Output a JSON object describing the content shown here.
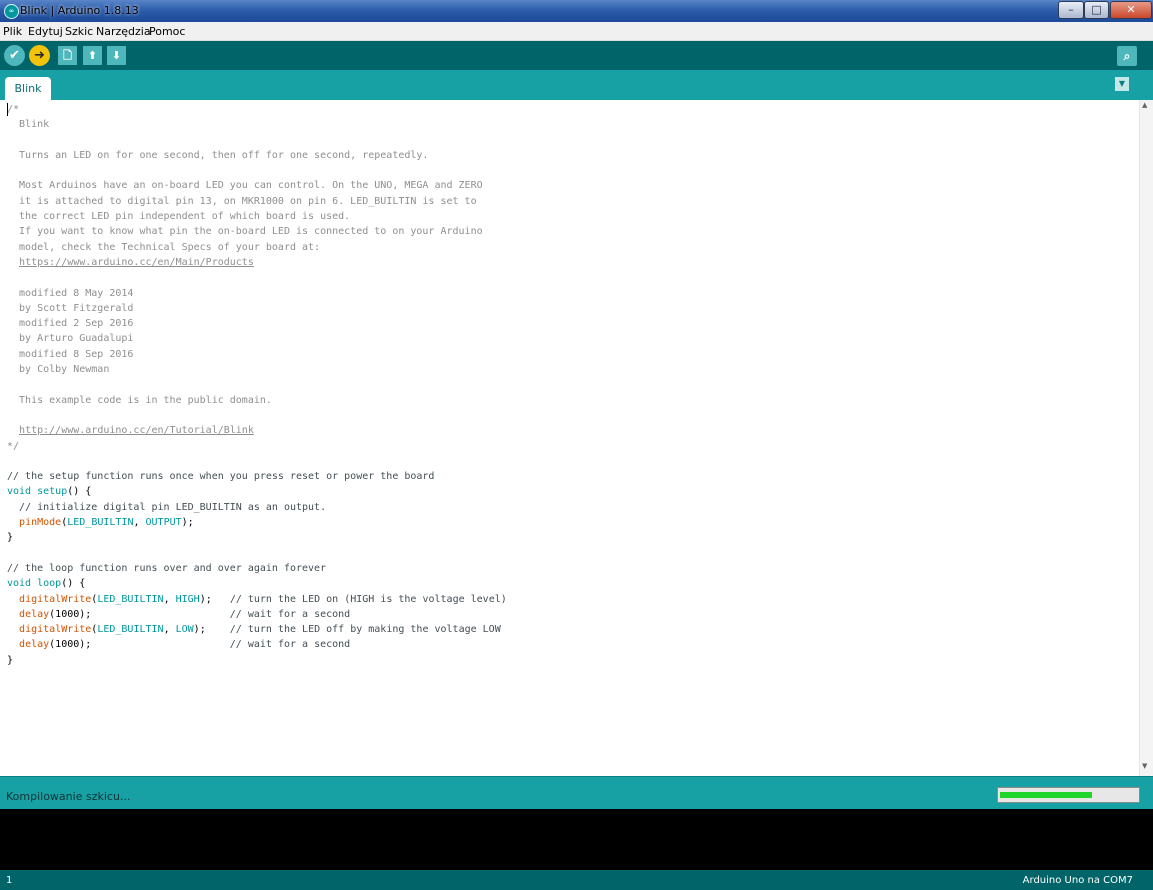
{
  "window": {
    "title": "Blink | Arduino 1.8.13",
    "app_icon": "arduino-logo",
    "minimize": "–",
    "maximize": "□",
    "close": "✕"
  },
  "menu": [
    "Plik",
    "Edytuj",
    "Szkic",
    "Narzędzia",
    "Pomoc"
  ],
  "toolbar": {
    "verify_icon": "✔",
    "upload_icon": "➜",
    "new_icon": "🗋",
    "open_icon": "⬆",
    "save_icon": "⬇",
    "serial_icon": "⌕"
  },
  "tabs": [
    {
      "label": "Blink"
    }
  ],
  "tab_menu_icon": "▼",
  "code": [
    "/*",
    "  Blink",
    "",
    "  Turns an LED on for one second, then off for one second, repeatedly.",
    "",
    "  Most Arduinos have an on-board LED you can control. On the UNO, MEGA and ZERO",
    "  it is attached to digital pin 13, on MKR1000 on pin 6. LED_BUILTIN is set to",
    "  the correct LED pin independent of which board is used.",
    "  If you want to know what pin the on-board LED is connected to on your Arduino",
    "  model, check the Technical Specs of your board at:",
    "  https://www.arduino.cc/en/Main/Products",
    "",
    "  modified 8 May 2014",
    "  by Scott Fitzgerald",
    "  modified 2 Sep 2016",
    "  by Arturo Guadalupi",
    "  modified 8 Sep 2016",
    "  by Colby Newman",
    "",
    "  This example code is in the public domain.",
    "",
    "  http://www.arduino.cc/en/Tutorial/Blink",
    "*/",
    "",
    "// the setup function runs once when you press reset or power the board",
    "void setup() {",
    "  // initialize digital pin LED_BUILTIN as an output.",
    "  pinMode(LED_BUILTIN, OUTPUT);",
    "}",
    "",
    "// the loop function runs over and over again forever",
    "void loop() {",
    "  digitalWrite(LED_BUILTIN, HIGH);   // turn the LED on (HIGH is the voltage level)",
    "  delay(1000);                       // wait for a second",
    "  digitalWrite(LED_BUILTIN, LOW);    // turn the LED off by making the voltage LOW",
    "  delay(1000);                       // wait for a second",
    "}"
  ],
  "status": {
    "text": "Kompilowanie szkicu...",
    "progress": 0.67
  },
  "bottom": {
    "line": "1",
    "board": "Arduino Uno na COM7"
  },
  "colors": {
    "teal_dark": "#006468",
    "teal": "#17a1a5",
    "progress_green": "#1fd42b"
  }
}
